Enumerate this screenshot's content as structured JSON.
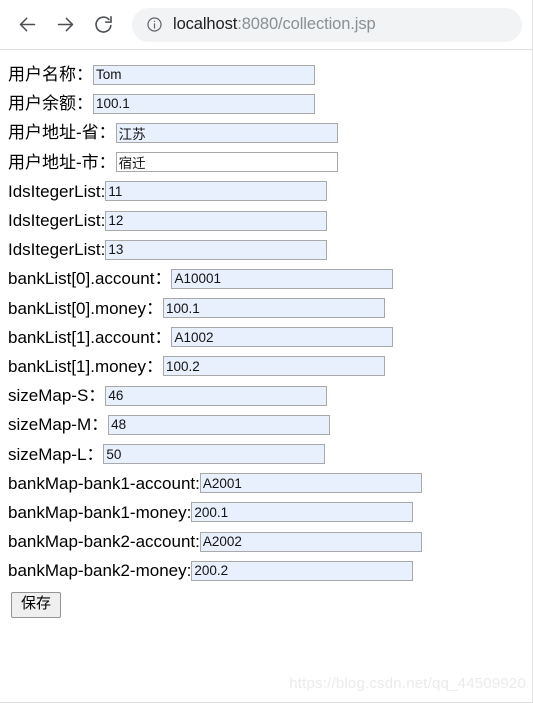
{
  "browser": {
    "back_label": "Back",
    "forward_label": "Forward",
    "reload_label": "Reload",
    "site_info_label": "View site information",
    "url_host": "localhost",
    "url_rest": ":8080/collection.jsp",
    "icons": {
      "back": "arrow-left-icon",
      "forward": "arrow-right-icon",
      "reload": "reload-icon",
      "site_info": "info-circle-icon"
    }
  },
  "form": {
    "rows": [
      {
        "label": "用户名称：",
        "value": "Tom",
        "filled": true
      },
      {
        "label": "用户余额：",
        "value": "100.1",
        "filled": true
      },
      {
        "label": "用户地址-省：",
        "value": "江苏",
        "filled": true
      },
      {
        "label": "用户地址-市：",
        "value": "宿迁",
        "filled": false
      },
      {
        "label": "IdsItegerList:",
        "value": "11",
        "filled": true
      },
      {
        "label": "IdsItegerList:",
        "value": "12",
        "filled": true
      },
      {
        "label": "IdsItegerList:",
        "value": "13",
        "filled": true
      },
      {
        "label": "bankList[0].account：",
        "value": "A10001",
        "filled": true
      },
      {
        "label": "bankList[0].money：",
        "value": "100.1",
        "filled": true
      },
      {
        "label": "bankList[1].account：",
        "value": "A1002",
        "filled": true
      },
      {
        "label": "bankList[1].money：",
        "value": "100.2",
        "filled": true
      },
      {
        "label": "sizeMap-S：",
        "value": "46",
        "filled": true
      },
      {
        "label": "sizeMap-M：",
        "value": "48",
        "filled": true
      },
      {
        "label": "sizeMap-L：",
        "value": "50",
        "filled": true
      },
      {
        "label": "bankMap-bank1-account:",
        "value": "A2001",
        "filled": true
      },
      {
        "label": "bankMap-bank1-money:",
        "value": "200.1",
        "filled": true
      },
      {
        "label": "bankMap-bank2-account:",
        "value": "A2002",
        "filled": true
      },
      {
        "label": "bankMap-bank2-money:",
        "value": "200.2",
        "filled": true
      }
    ],
    "save_label": "保存"
  },
  "watermark": "https://blog.csdn.net/qq_44509920"
}
